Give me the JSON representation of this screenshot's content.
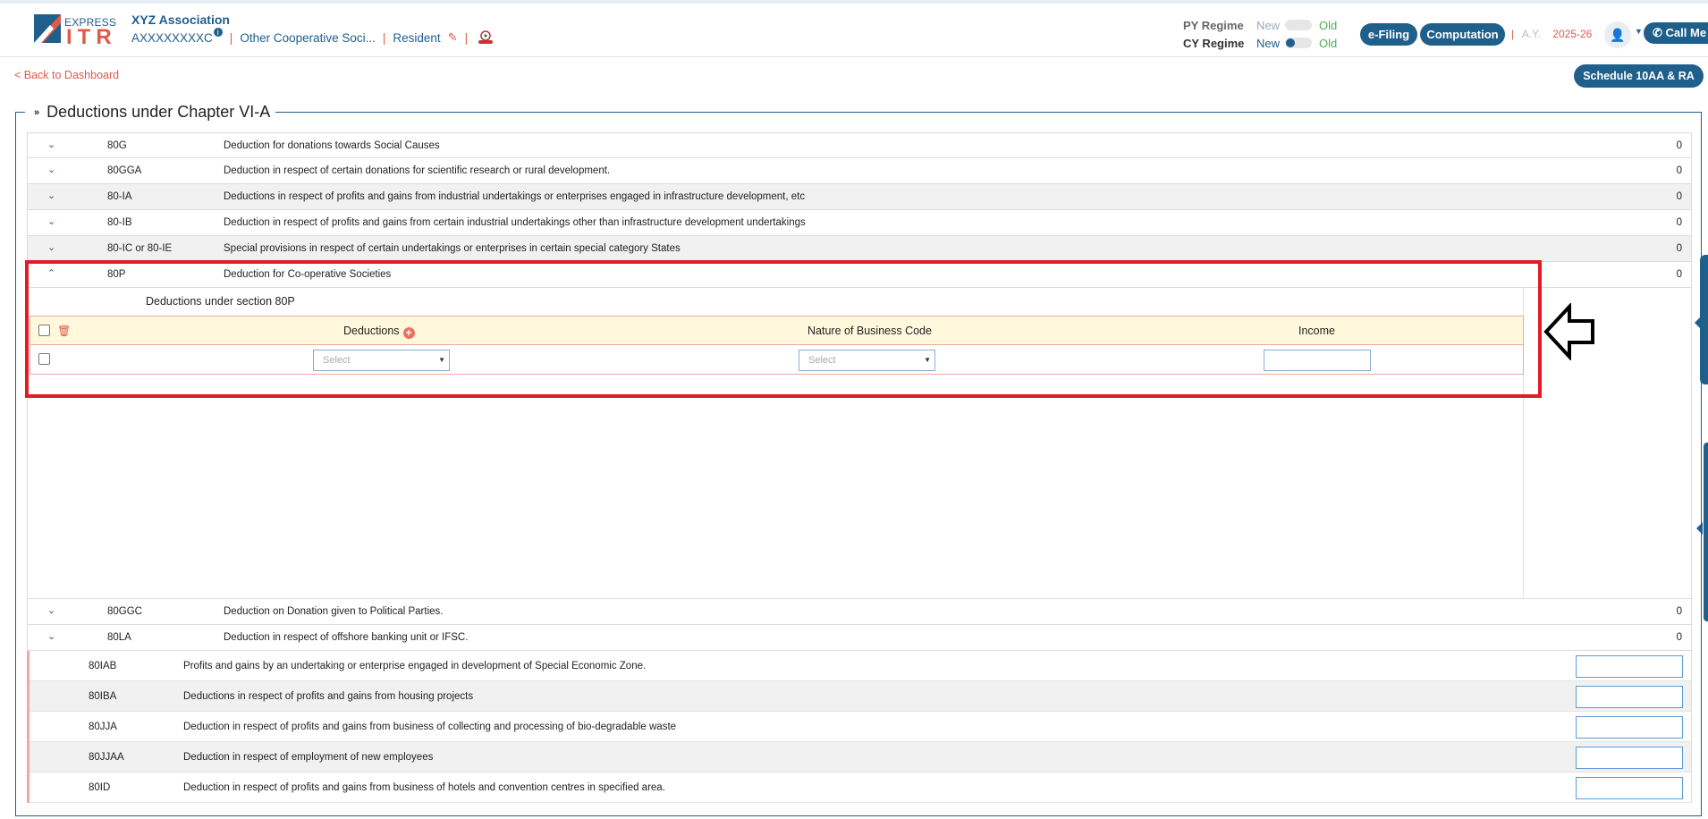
{
  "header": {
    "logo_express": "EXPRESS",
    "logo_itr": "ITR",
    "org_name": "XYZ Association",
    "pan": "AXXXXXXXXC",
    "info_badge": "i",
    "entity_type": "Other Cooperative Soci...",
    "residency": "Resident",
    "py_regime_label": "PY Regime",
    "cy_regime_label": "CY Regime",
    "regime_new": "New",
    "regime_old": "Old",
    "efiling_label": "e-Filing",
    "computation_label": "Computation",
    "ay_label": "A.Y.",
    "ay_value": "2025-26",
    "call_me_label": "Call Me"
  },
  "nav": {
    "back_label": "< Back to Dashboard",
    "schedule_button": "Schedule 10AA & RA"
  },
  "section": {
    "title": "Deductions under Chapter VI-A"
  },
  "rows_top": [
    {
      "code": "80G",
      "desc": "Deduction for donations towards Social Causes",
      "amount": "0"
    },
    {
      "code": "80GGA",
      "desc": "Deduction in respect of certain donations for scientific research or rural development.",
      "amount": "0"
    },
    {
      "code": "80-IA",
      "desc": "Deductions in respect of profits and gains from industrial undertakings or enterprises engaged in infrastructure development, etc",
      "amount": "0"
    },
    {
      "code": "80-IB",
      "desc": "Deduction in respect of profits and gains from certain industrial undertakings other than infrastructure development undertakings",
      "amount": "0"
    },
    {
      "code": "80-IC or 80-IE",
      "desc": "Special provisions in respect of certain undertakings or enterprises in certain special category States",
      "amount": "0"
    }
  ],
  "row_80p": {
    "code": "80P",
    "desc": "Deduction for Co-operative Societies",
    "amount": "0"
  },
  "panel_80p": {
    "title": "Deductions under section 80P",
    "col_deductions": "Deductions",
    "col_nature": "Nature of Business Code",
    "col_income": "Income",
    "select_placeholder": "Select",
    "income_value": ""
  },
  "rows_bottom": [
    {
      "code": "80GGC",
      "desc": "Deduction on Donation given to Political Parties.",
      "amount": "0"
    },
    {
      "code": "80LA",
      "desc": "Deduction in respect of offshore banking unit or IFSC.",
      "amount": "0"
    }
  ],
  "sub_rows": [
    {
      "code": "80IAB",
      "desc": "Profits and gains by an undertaking or enterprise engaged in development of Special Economic Zone.",
      "value": ""
    },
    {
      "code": "80IBA",
      "desc": "Deductions in respect of profits and gains from housing projects",
      "value": ""
    },
    {
      "code": "80JJA",
      "desc": "Deduction in respect of profits and gains from business of collecting and processing of bio-degradable waste",
      "value": ""
    },
    {
      "code": "80JJAA",
      "desc": "Deduction in respect of employment of new employees",
      "value": ""
    },
    {
      "code": "80ID",
      "desc": "Deduction in respect of profits and gains from business of hotels and convention centres in specified area.",
      "value": ""
    }
  ],
  "colors": {
    "brand_blue": "#1f5f8b",
    "accent_red": "#e05a4a",
    "highlight_red": "#e21c24"
  }
}
